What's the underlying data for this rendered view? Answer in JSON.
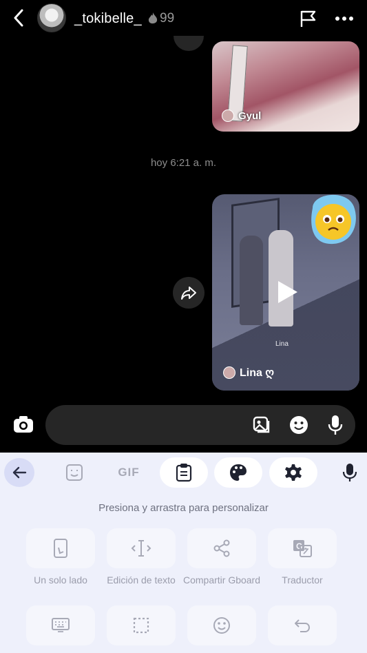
{
  "header": {
    "username": "_tokibelle_",
    "streak_count": "99",
    "icons": [
      "back-arrow-icon",
      "flag-icon",
      "more-icon"
    ]
  },
  "messages": {
    "top_image_credit": "Gyul",
    "timestamp": "hoy 6:21 a. m.",
    "video_caption": "Lina",
    "video_credit": "Lina ღ"
  },
  "composer": {
    "placeholder": "",
    "icons": [
      "camera-icon",
      "gallery-icon",
      "sticker-icon",
      "microphone-icon"
    ]
  },
  "keyboard": {
    "toolbar": {
      "gif_label": "GIF",
      "icons": [
        "back-arrow-icon",
        "sticker-icon",
        "clipboard-icon",
        "palette-icon",
        "settings-icon",
        "microphone-icon"
      ]
    },
    "hint": "Presiona y arrastra para personalizar",
    "tiles_row1": [
      {
        "label": "Un solo lado",
        "icon": "one-handed-icon"
      },
      {
        "label": "Edición de texto",
        "icon": "text-cursor-icon"
      },
      {
        "label": "Compartir Gboard",
        "icon": "share-icon"
      },
      {
        "label": "Traductor",
        "icon": "translate-icon"
      }
    ],
    "tiles_row2_icons": [
      "keyboard-icon",
      "select-icon",
      "emoji-icon",
      "undo-icon"
    ]
  },
  "colors": {
    "background": "#000000",
    "bubble": "#262626",
    "keyboard_bg": "#eef0fb",
    "accent_chip": "#d8dcf6"
  }
}
